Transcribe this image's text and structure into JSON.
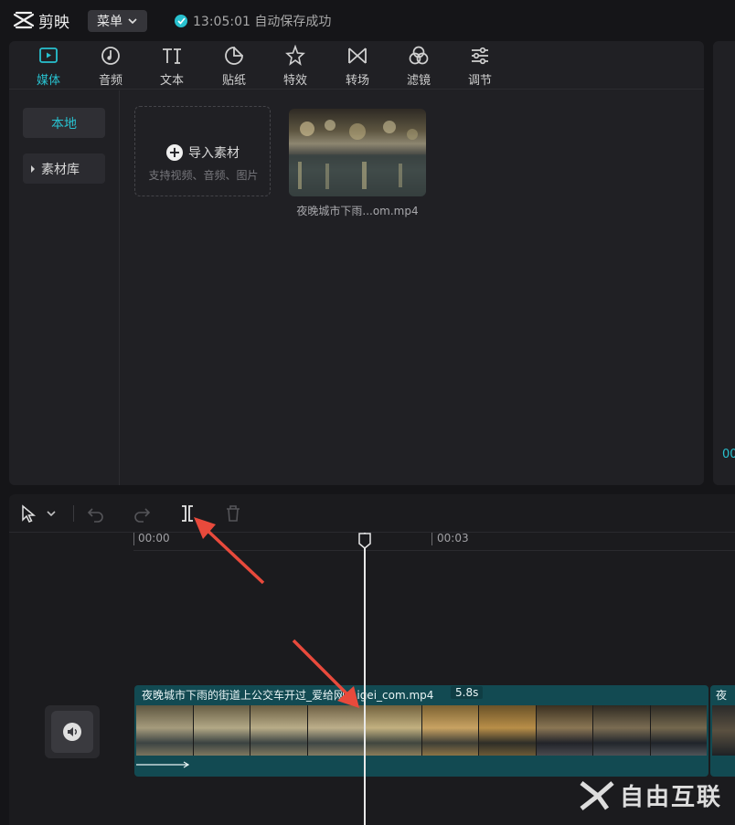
{
  "app": {
    "name": "剪映",
    "menu_label": "菜单",
    "autosave_text": "13:05:01 自动保存成功"
  },
  "tabs": [
    {
      "label": "媒体",
      "icon": "media-icon",
      "active": true
    },
    {
      "label": "音频",
      "icon": "audio-icon"
    },
    {
      "label": "文本",
      "icon": "text-icon"
    },
    {
      "label": "贴纸",
      "icon": "sticker-icon"
    },
    {
      "label": "特效",
      "icon": "effects-icon"
    },
    {
      "label": "转场",
      "icon": "transition-icon"
    },
    {
      "label": "滤镜",
      "icon": "filter-icon"
    },
    {
      "label": "调节",
      "icon": "adjust-icon"
    }
  ],
  "sidebar": {
    "local_label": "本地",
    "library_label": "素材库"
  },
  "import": {
    "title": "导入素材",
    "subtitle": "支持视频、音频、图片"
  },
  "media_item": {
    "filename": "夜晚城市下雨...om.mp4"
  },
  "timeline": {
    "ruler_start": "00:00",
    "ruler_mid": "00:03",
    "clip_name": "夜晚城市下雨的街道上公交车开过_爱给网_aigei_com.mp4",
    "clip_duration": "5.8s",
    "clip2_name": "夜",
    "right_timecode": "00"
  },
  "watermark": "自由互联",
  "colors": {
    "accent": "#28c1cf",
    "clip": "#124a52",
    "arrow": "#e84a3c"
  }
}
